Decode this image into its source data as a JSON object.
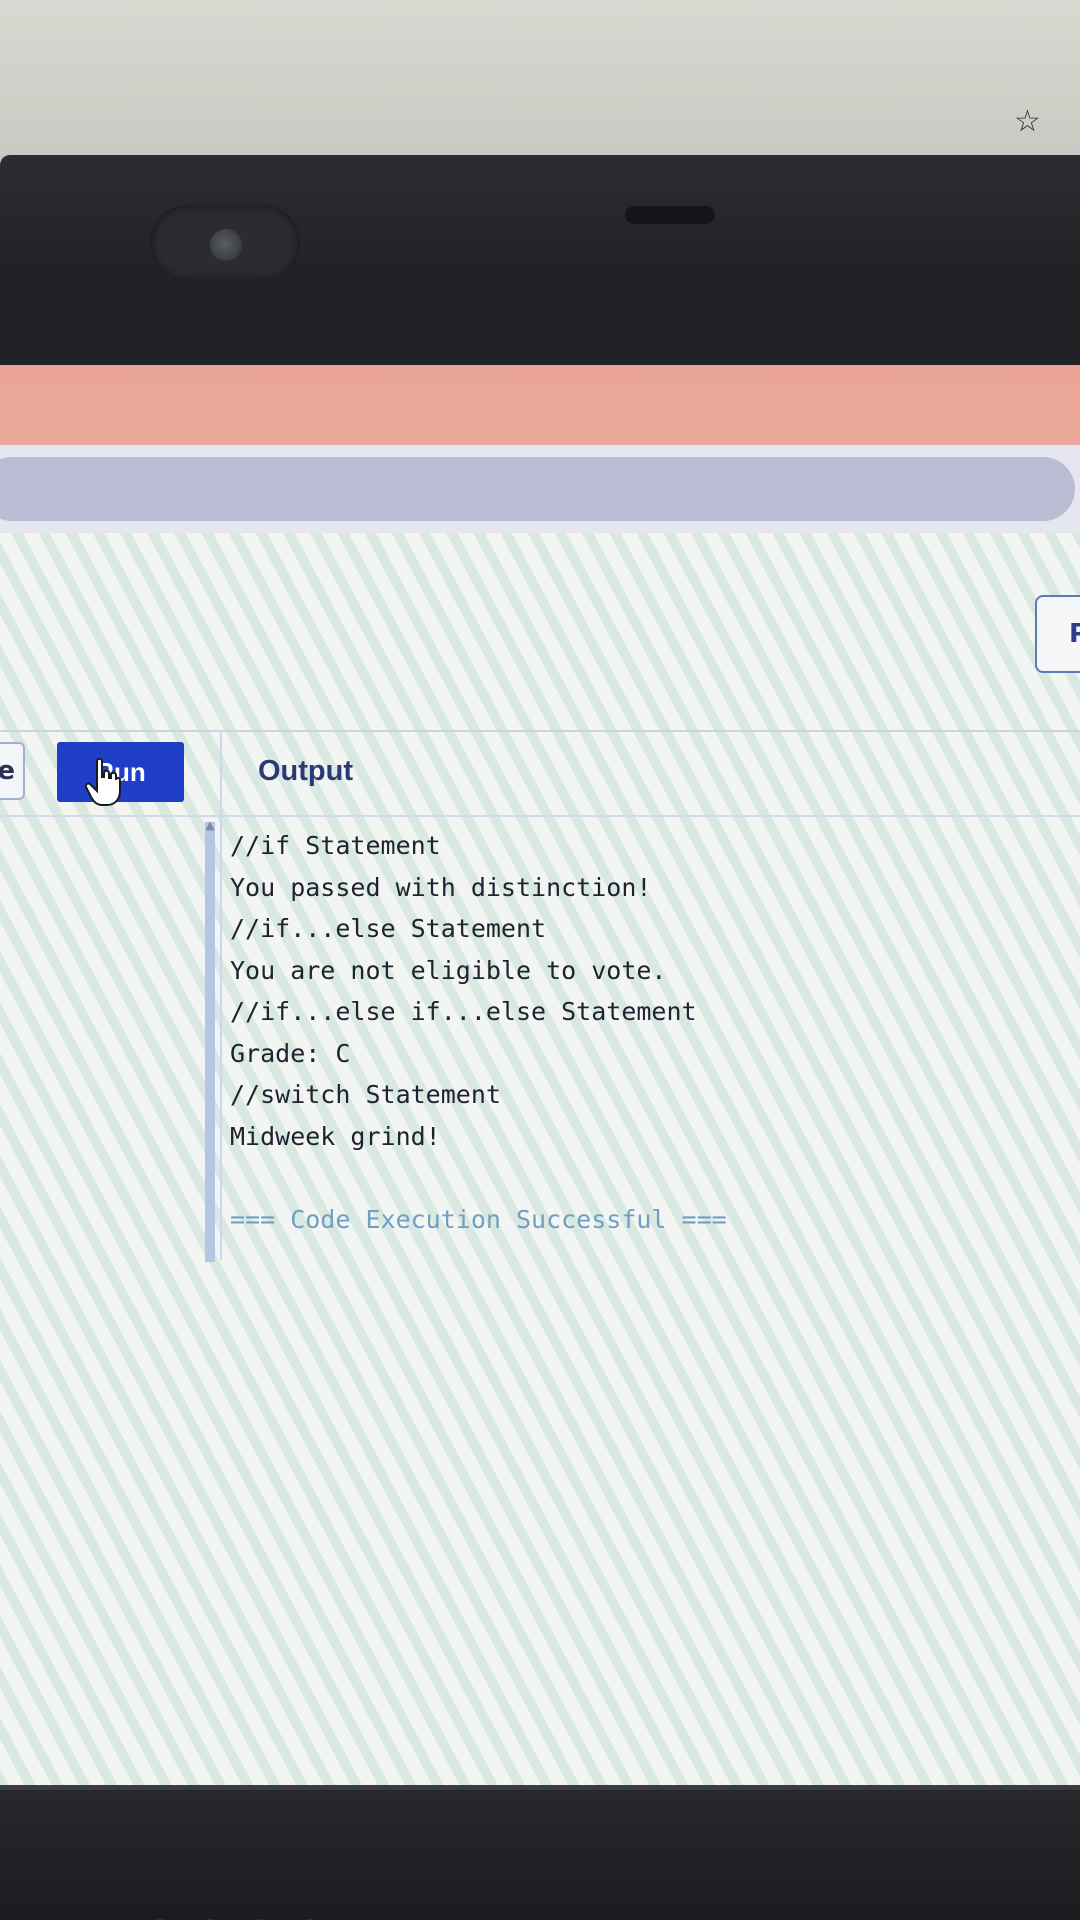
{
  "browser": {
    "bookmark_icon": "star-outline-icon"
  },
  "page": {
    "top_right_button_label": "P",
    "left_stub_label": "e"
  },
  "editor": {
    "run_label": "Run",
    "output_title": "Output",
    "output_lines": [
      "//if Statement",
      "You passed with distinction!",
      "//if...else Statement",
      "You are not eligible to vote.",
      "//if...else if...else Statement",
      "Grade: C",
      "//switch Statement",
      "Midweek grind!",
      "",
      "=== Code Execution Successful ==="
    ]
  },
  "colors": {
    "run_button": "#1f3fc9",
    "success_text": "#6f9fc2",
    "tab_bar": "#e9a494"
  }
}
